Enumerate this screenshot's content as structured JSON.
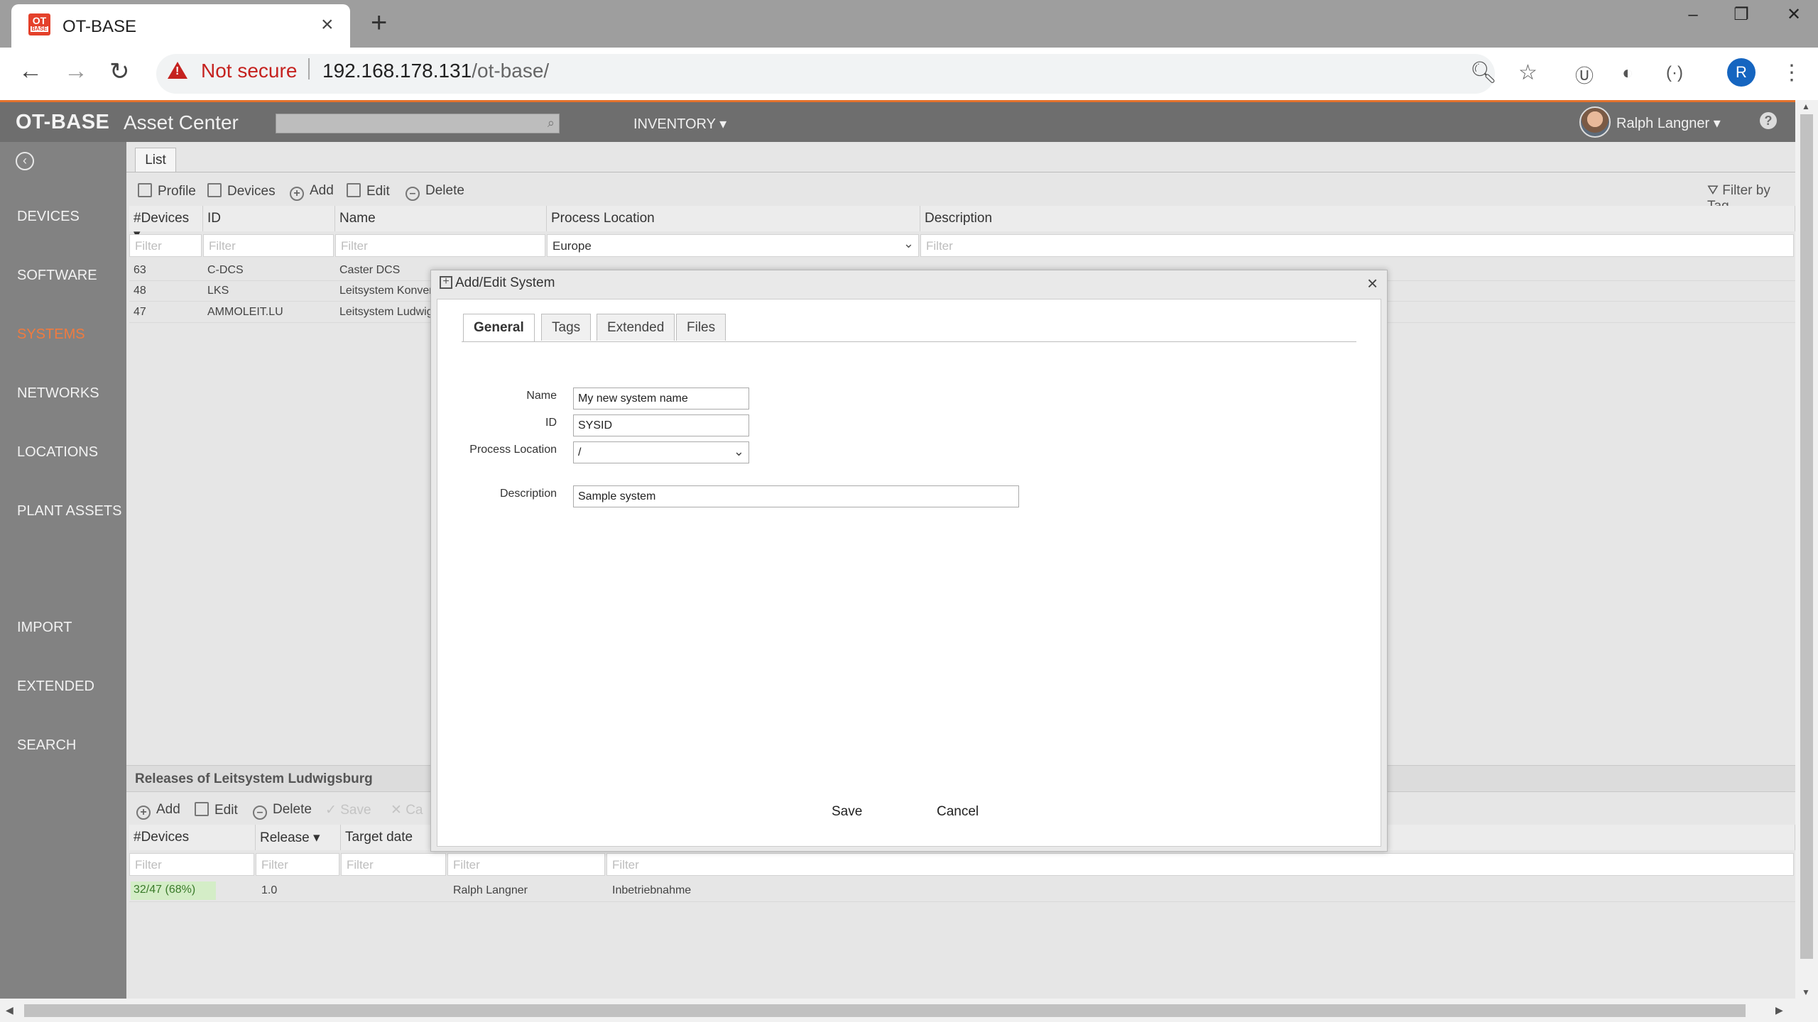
{
  "browser": {
    "tab_title": "OT-BASE",
    "favicon_text": "OT",
    "favicon_subtext": "BASE",
    "security_label": "Not secure",
    "url_host": "192.168.178.131",
    "url_path": "/ot-base/",
    "profile_initial": "R"
  },
  "header": {
    "brand": "OT-BASE",
    "subtitle": "Asset Center",
    "inventory_menu": "INVENTORY ▾",
    "user_name": "Ralph Langner ▾",
    "help": "?"
  },
  "sidebar": {
    "items": [
      {
        "label": "DEVICES"
      },
      {
        "label": "SOFTWARE"
      },
      {
        "label": "SYSTEMS",
        "active": true
      },
      {
        "label": "NETWORKS"
      },
      {
        "label": "LOCATIONS"
      },
      {
        "label": "PLANT ASSETS"
      },
      {
        "label": "IMPORT"
      },
      {
        "label": "EXTENDED"
      },
      {
        "label": "SEARCH"
      }
    ]
  },
  "main": {
    "tab_label": "List",
    "toolbar": {
      "profile": "Profile",
      "devices": "Devices",
      "add": "Add",
      "edit": "Edit",
      "delete": "Delete",
      "filter_by_tag": "Filter by Tag"
    },
    "columns": [
      "#Devices ▾",
      "ID",
      "Name",
      "Process Location",
      "Description"
    ],
    "filter_placeholder": "Filter",
    "process_location_filter": "Europe",
    "rows": [
      {
        "devices": "63",
        "id": "C-DCS",
        "name": "Caster DCS"
      },
      {
        "devices": "48",
        "id": "LKS",
        "name": "Leitsystem Konvert"
      },
      {
        "devices": "47",
        "id": "AMMOLEIT.LU",
        "name": "Leitsystem Ludwigs"
      }
    ]
  },
  "releases": {
    "title": "Releases of Leitsystem Ludwigsburg",
    "toolbar": {
      "add": "Add",
      "edit": "Edit",
      "delete": "Delete",
      "save": "Save",
      "cancel": "Ca"
    },
    "columns": [
      "#Devices",
      "Release ▾",
      "Target date"
    ],
    "filter_placeholder": "Filter",
    "row": {
      "progress": "32/47 (68%)",
      "progress_fraction": 0.68,
      "release": "1.0",
      "owner": "Ralph Langner",
      "status": "Inbetriebnahme"
    }
  },
  "modal": {
    "title": "Add/Edit System",
    "close": "×",
    "tabs": [
      "General",
      "Tags",
      "Extended",
      "Files"
    ],
    "active_tab": "General",
    "fields": {
      "name_label": "Name",
      "name_value": "My new system name",
      "id_label": "ID",
      "id_value": "SYSID",
      "process_location_label": "Process Location",
      "process_location_value": "/",
      "description_label": "Description",
      "description_value": "Sample system"
    },
    "save_label": "Save",
    "cancel_label": "Cancel"
  }
}
